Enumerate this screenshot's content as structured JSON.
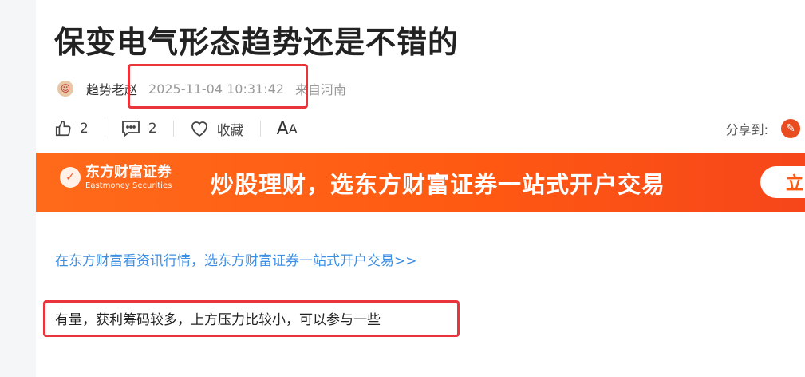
{
  "article": {
    "title": "保变电气形态趋势还是不错的",
    "author": "趋势老赵",
    "timestamp": "2025-11-04 10:31:42",
    "location": "来自河南",
    "promo_link": "在东方财富看资讯行情，选东方财富证券一站式开户交易>>",
    "body": "有量，获利筹码较多，上方压力比较小，可以参与一些"
  },
  "actions": {
    "like_count": "2",
    "comment_count": "2",
    "favorite_label": "收藏",
    "font_big": "A",
    "font_small": "A",
    "share_label": "分享到:"
  },
  "banner": {
    "brand_cn": "东方财富证券",
    "brand_en": "Eastmoney Securities",
    "slogan": "炒股理财，选东方财富证券一站式开户交易",
    "button_label": "立"
  },
  "colors": {
    "highlight_box": "#e8343a",
    "link": "#3d8fe3",
    "banner": "#ff5a12"
  }
}
